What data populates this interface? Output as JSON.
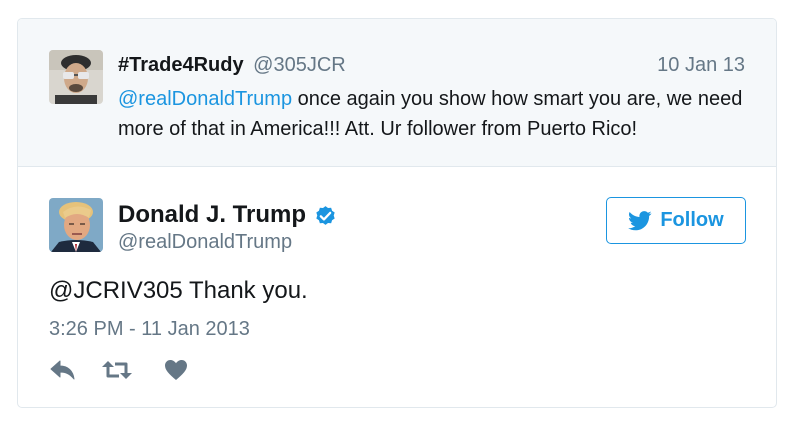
{
  "parent_tweet": {
    "display_name": "#Trade4Rudy",
    "handle": "@305JCR",
    "date": "10 Jan 13",
    "mention": "@realDonaldTrump",
    "text": " once again you show how smart you are, we need more of that in America!!! Att. Ur follower from Puerto Rico!"
  },
  "main_tweet": {
    "display_name": "Donald J. Trump",
    "handle": "@realDonaldTrump",
    "text": "@JCRIV305 Thank you.",
    "timestamp": "3:26 PM - 11 Jan 2013"
  },
  "follow_button": {
    "label": "Follow",
    "icon": "twitter-bird-icon"
  },
  "icons": {
    "verified": "verified-badge-icon",
    "reply": "reply-icon",
    "retweet": "retweet-icon",
    "like": "heart-icon"
  },
  "colors": {
    "link_blue": "#1b95e0",
    "text_dark": "#14171a",
    "text_gray": "#657786",
    "parent_background": "#f5f8fa",
    "border": "#e1e8ed",
    "action_icon": "#657786"
  }
}
